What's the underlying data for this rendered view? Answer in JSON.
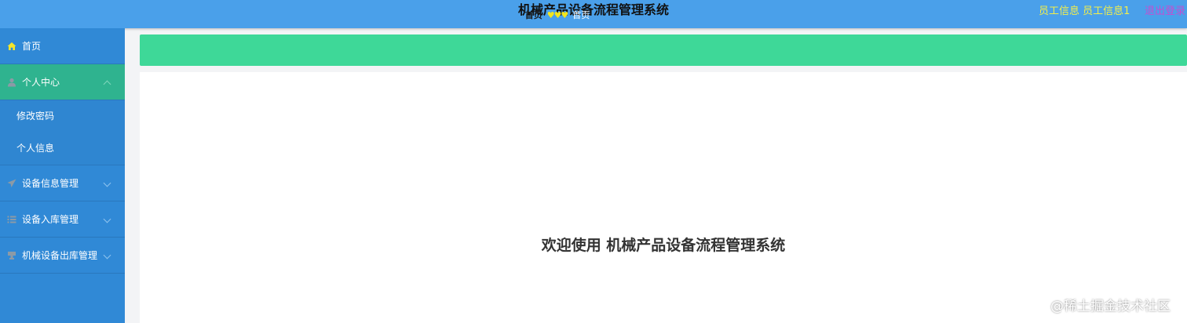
{
  "header": {
    "title": "机械产品设备流程管理系统",
    "user_label": "员工信息 员工信息1",
    "logout_label": "退出登录"
  },
  "sidebar": {
    "items": [
      {
        "label": "首页",
        "icon": "home-icon",
        "active": false
      },
      {
        "label": "个人中心",
        "icon": "user-icon",
        "active": true,
        "children": [
          {
            "label": "修改密码"
          },
          {
            "label": "个人信息"
          }
        ]
      },
      {
        "label": "设备信息管理",
        "icon": "send-icon",
        "active": false
      },
      {
        "label": "设备入库管理",
        "icon": "list-icon",
        "active": false
      },
      {
        "label": "机械设备出库管理",
        "icon": "cup-icon",
        "active": false
      }
    ]
  },
  "breadcrumb": {
    "home": "首页",
    "separator": "♥♥♥",
    "current": "首页"
  },
  "main": {
    "welcome": "欢迎使用 机械产品设备流程管理系统"
  },
  "watermark": "@稀土掘金技术社区",
  "colors": {
    "header_bg": "#4aa0ea",
    "sidebar_bg": "#3089d6",
    "active_menu_bg": "#2fb38f",
    "breadcrumb_bg": "#3ed898",
    "user_text": "#f3ee4a",
    "logout_text": "#c34fd1"
  }
}
